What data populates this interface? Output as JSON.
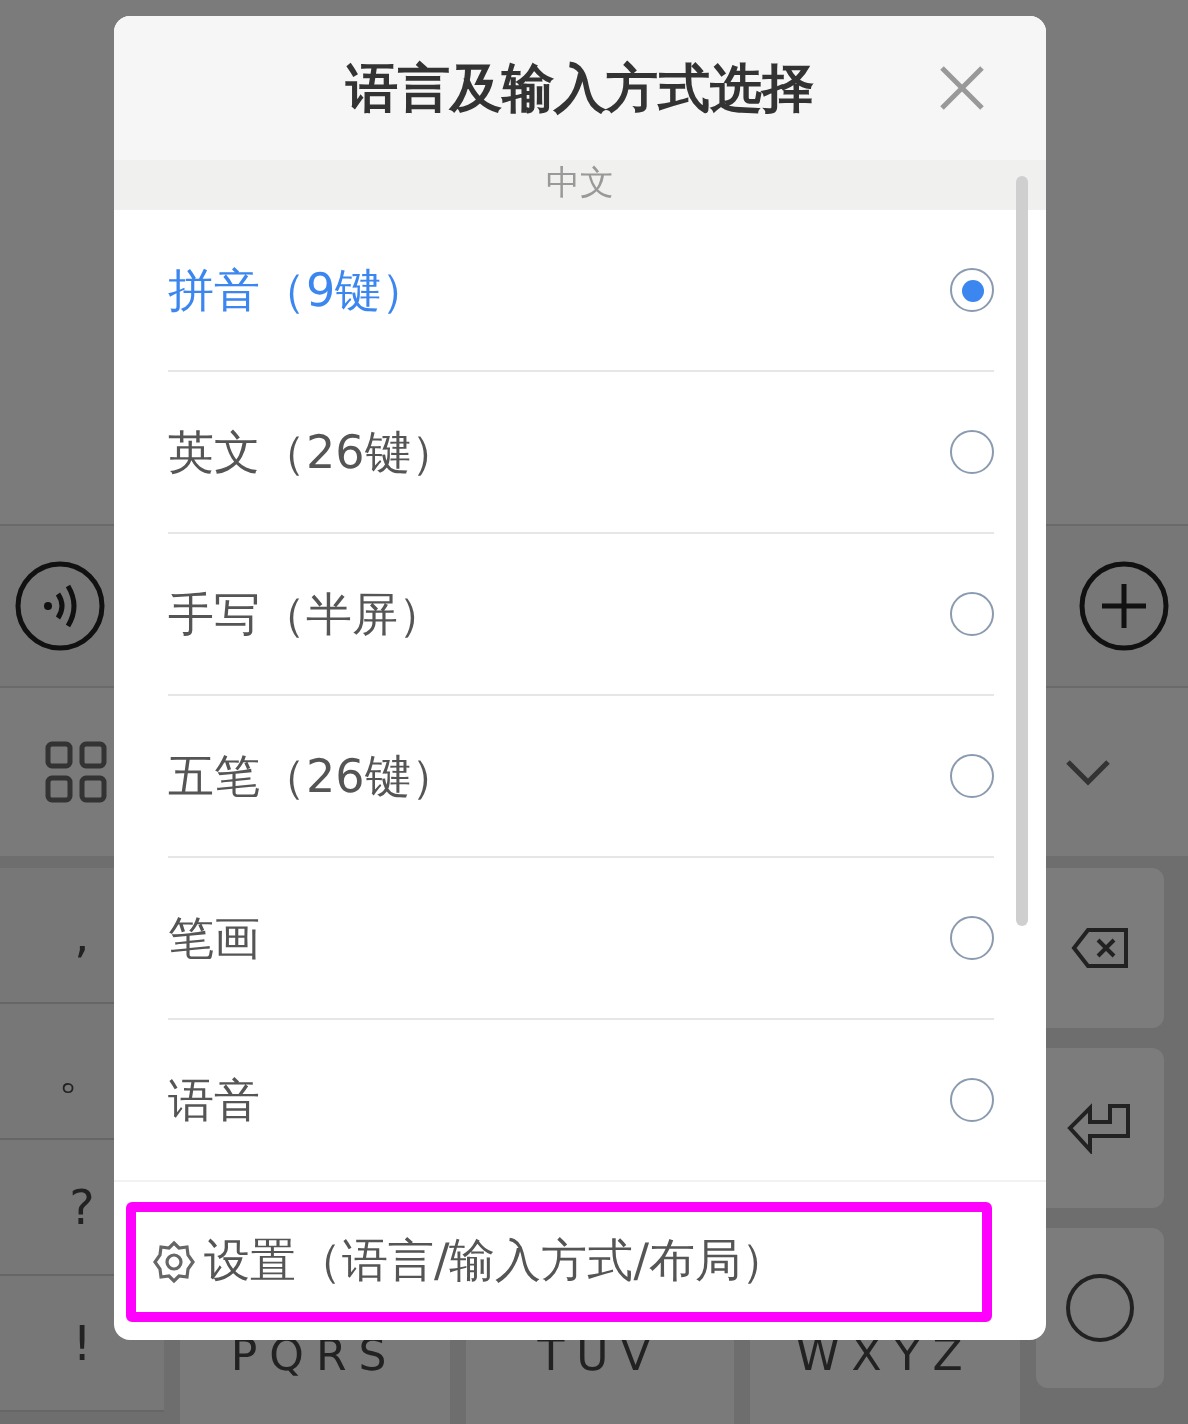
{
  "background_keyboard": {
    "symbol_keys": [
      ",",
      "。",
      "?",
      "!"
    ],
    "letter_keys": [
      "PQRS",
      "TUV",
      "WXYZ"
    ]
  },
  "dialog": {
    "title": "语言及输入方式选择",
    "section": "中文",
    "options": [
      {
        "label": "拼音（9键）",
        "selected": true
      },
      {
        "label": "英文（26键）",
        "selected": false
      },
      {
        "label": "手写（半屏）",
        "selected": false
      },
      {
        "label": "五笔（26键）",
        "selected": false
      },
      {
        "label": "笔画",
        "selected": false
      },
      {
        "label": "语音",
        "selected": false
      }
    ],
    "settings_link": {
      "label": "设置（语言/输入方式/布局）",
      "highlighted": true
    }
  }
}
